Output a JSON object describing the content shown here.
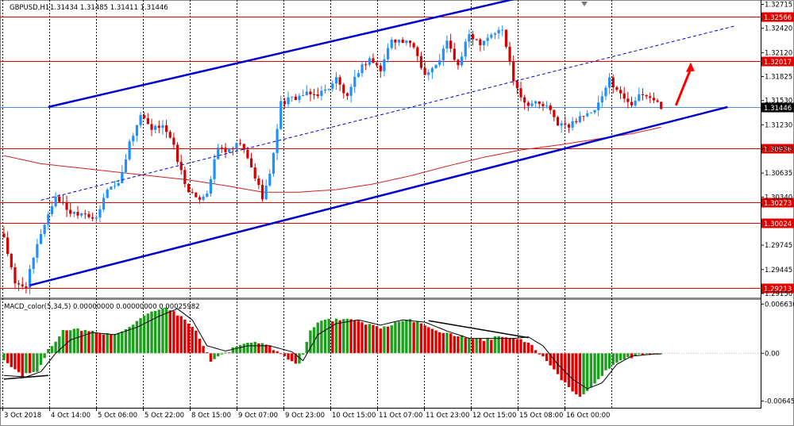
{
  "header": {
    "symbol": "GBPUSD,H1",
    "ohlc": "1.31434 1.31485 1.31411 1.31446"
  },
  "colors": {
    "bull": "#1e90ff",
    "bear": "#d40000",
    "hist_up": "#1aa01a",
    "hist_down": "#e00000",
    "channel": "#0000cc",
    "level": "#e00000",
    "ma": "#cc2222",
    "price_line": "#5a8cd6",
    "grid": "#000000",
    "arrow": "#ff0000"
  },
  "chart_data": [
    {
      "type": "candlestick",
      "title": "GBPUSD,H1",
      "ylim": [
        1.2911,
        1.3275
      ],
      "yticks": [
        "1.32715",
        "1.32420",
        "1.32120",
        "1.31825",
        "1.31530",
        "1.31230",
        "1.30935",
        "1.30635",
        "1.30340",
        "1.29745",
        "1.29445",
        "1.29150"
      ],
      "xticks": [
        "3 Oct 2018",
        "4 Oct 14:00",
        "5 Oct 06:00",
        "5 Oct 22:00",
        "8 Oct 15:00",
        "9 Oct 07:00",
        "9 Oct 23:00",
        "10 Oct 15:00",
        "11 Oct 07:00",
        "11 Oct 23:00",
        "12 Oct 15:00",
        "15 Oct 08:00",
        "16 Oct 00:00"
      ],
      "levels": [
        "1.32566",
        "1.32017",
        "1.30936",
        "1.30273",
        "1.30024",
        "1.29213"
      ],
      "current_price": "1.31446",
      "close_path": [
        [
          0,
          1.2985
        ],
        [
          3,
          1.2925
        ],
        [
          6,
          1.2925
        ],
        [
          10,
          1.299
        ],
        [
          14,
          1.3035
        ],
        [
          18,
          1.3015
        ],
        [
          22,
          1.3015
        ],
        [
          25,
          1.3005
        ],
        [
          28,
          1.3045
        ],
        [
          31,
          1.305
        ],
        [
          34,
          1.31
        ],
        [
          37,
          1.3135
        ],
        [
          40,
          1.3115
        ],
        [
          43,
          1.3125
        ],
        [
          46,
          1.3095
        ],
        [
          49,
          1.305
        ],
        [
          52,
          1.303
        ],
        [
          55,
          1.304
        ],
        [
          58,
          1.3095
        ],
        [
          61,
          1.309
        ],
        [
          64,
          1.31
        ],
        [
          67,
          1.307
        ],
        [
          70,
          1.3035
        ],
        [
          72,
          1.306
        ],
        [
          75,
          1.315
        ],
        [
          78,
          1.3155
        ],
        [
          81,
          1.316
        ],
        [
          84,
          1.316
        ],
        [
          87,
          1.3165
        ],
        [
          90,
          1.318
        ],
        [
          93,
          1.3155
        ],
        [
          96,
          1.319
        ],
        [
          99,
          1.3205
        ],
        [
          102,
          1.319
        ],
        [
          105,
          1.323
        ],
        [
          108,
          1.3225
        ],
        [
          111,
          1.322
        ],
        [
          114,
          1.3185
        ],
        [
          117,
          1.3195
        ],
        [
          120,
          1.3225
        ],
        [
          123,
          1.3195
        ],
        [
          126,
          1.3235
        ],
        [
          129,
          1.3225
        ],
        [
          132,
          1.3235
        ],
        [
          135,
          1.324
        ],
        [
          138,
          1.318
        ],
        [
          141,
          1.315
        ],
        [
          144,
          1.315
        ],
        [
          147,
          1.3145
        ],
        [
          150,
          1.3125
        ],
        [
          153,
          1.312
        ],
        [
          156,
          1.3135
        ],
        [
          159,
          1.3135
        ],
        [
          162,
          1.3155
        ],
        [
          164,
          1.318
        ],
        [
          167,
          1.316
        ],
        [
          170,
          1.315
        ],
        [
          173,
          1.316
        ],
        [
          176,
          1.3155
        ],
        [
          178,
          1.3145
        ]
      ],
      "ma": [
        [
          0,
          1.3085
        ],
        [
          10,
          1.3075
        ],
        [
          20,
          1.307
        ],
        [
          30,
          1.3065
        ],
        [
          40,
          1.306
        ],
        [
          50,
          1.3055
        ],
        [
          60,
          1.3048
        ],
        [
          70,
          1.304
        ],
        [
          80,
          1.304
        ],
        [
          90,
          1.3043
        ],
        [
          100,
          1.305
        ],
        [
          110,
          1.306
        ],
        [
          120,
          1.3072
        ],
        [
          130,
          1.3083
        ],
        [
          140,
          1.3092
        ],
        [
          150,
          1.3098
        ],
        [
          160,
          1.3105
        ],
        [
          170,
          1.3112
        ],
        [
          178,
          1.312
        ]
      ],
      "channel_upper": [
        [
          12,
          1.3145
        ],
        [
          140,
          1.328
        ]
      ],
      "channel_lower": [
        [
          7,
          1.2925
        ],
        [
          196,
          1.3145
        ]
      ],
      "channel_mid": [
        [
          10,
          1.303
        ],
        [
          198,
          1.3245
        ]
      ],
      "forecast_arrow": [
        [
          182,
          1.3147
        ],
        [
          186,
          1.32
        ]
      ]
    },
    {
      "type": "bar",
      "title": "MACD_color(5,34,5) 0.00000000 0.00000000 0.00025982",
      "ylim": [
        -0.00715,
        0.0071
      ],
      "yticks": [
        "0.006636",
        "0.00",
        "-0.006458"
      ],
      "histogram": [
        [
          0,
          -0.001
        ],
        [
          5,
          -0.003
        ],
        [
          9,
          -0.0025
        ],
        [
          12,
          0.0005
        ],
        [
          16,
          0.003
        ],
        [
          20,
          0.0032
        ],
        [
          25,
          0.0028
        ],
        [
          30,
          0.0025
        ],
        [
          35,
          0.004
        ],
        [
          40,
          0.0055
        ],
        [
          44,
          0.006
        ],
        [
          48,
          0.005
        ],
        [
          52,
          0.003
        ],
        [
          56,
          -0.001
        ],
        [
          60,
          0.0
        ],
        [
          64,
          0.0012
        ],
        [
          68,
          0.0015
        ],
        [
          72,
          0.001
        ],
        [
          76,
          -0.0005
        ],
        [
          80,
          -0.0015
        ],
        [
          83,
          0.003
        ],
        [
          86,
          0.0045
        ],
        [
          90,
          0.0045
        ],
        [
          94,
          0.0045
        ],
        [
          98,
          0.004
        ],
        [
          102,
          0.0035
        ],
        [
          106,
          0.004
        ],
        [
          110,
          0.0045
        ],
        [
          114,
          0.0038
        ],
        [
          118,
          0.003
        ],
        [
          122,
          0.0025
        ],
        [
          126,
          0.002
        ],
        [
          130,
          0.0018
        ],
        [
          134,
          0.0022
        ],
        [
          138,
          0.002
        ],
        [
          142,
          0.0015
        ],
        [
          146,
          -0.0005
        ],
        [
          150,
          -0.003
        ],
        [
          154,
          -0.005
        ],
        [
          156,
          -0.006
        ],
        [
          160,
          -0.004
        ],
        [
          164,
          -0.002
        ],
        [
          168,
          -0.0008
        ],
        [
          172,
          -0.0002
        ],
        [
          176,
          0.0
        ],
        [
          180,
          -0.0002
        ]
      ],
      "signal": [
        [
          0,
          -0.003
        ],
        [
          6,
          -0.0032
        ],
        [
          10,
          -0.0025
        ],
        [
          14,
          0.0
        ],
        [
          18,
          0.0018
        ],
        [
          24,
          0.0028
        ],
        [
          30,
          0.0025
        ],
        [
          36,
          0.0035
        ],
        [
          42,
          0.005
        ],
        [
          47,
          0.006
        ],
        [
          51,
          0.0045
        ],
        [
          55,
          0.001
        ],
        [
          60,
          0.0003
        ],
        [
          66,
          0.001
        ],
        [
          72,
          0.001
        ],
        [
          78,
          0.0002
        ],
        [
          81,
          -0.001
        ],
        [
          85,
          0.0025
        ],
        [
          90,
          0.004
        ],
        [
          96,
          0.0045
        ],
        [
          102,
          0.0038
        ],
        [
          108,
          0.0045
        ],
        [
          114,
          0.0042
        ],
        [
          120,
          0.003
        ],
        [
          126,
          0.002
        ],
        [
          132,
          0.002
        ],
        [
          138,
          0.002
        ],
        [
          142,
          0.0022
        ],
        [
          146,
          0.001
        ],
        [
          150,
          -0.0015
        ],
        [
          154,
          -0.0035
        ],
        [
          158,
          -0.0048
        ],
        [
          162,
          -0.004
        ],
        [
          166,
          -0.0015
        ],
        [
          170,
          -0.0004
        ],
        [
          176,
          -0.0001
        ],
        [
          180,
          -0.0001
        ]
      ],
      "trendlines": [
        [
          [
            0,
            -0.0035
          ],
          [
            12,
            -0.003
          ]
        ],
        [
          [
            115,
            0.0044
          ],
          [
            142,
            0.0021
          ]
        ]
      ]
    }
  ]
}
